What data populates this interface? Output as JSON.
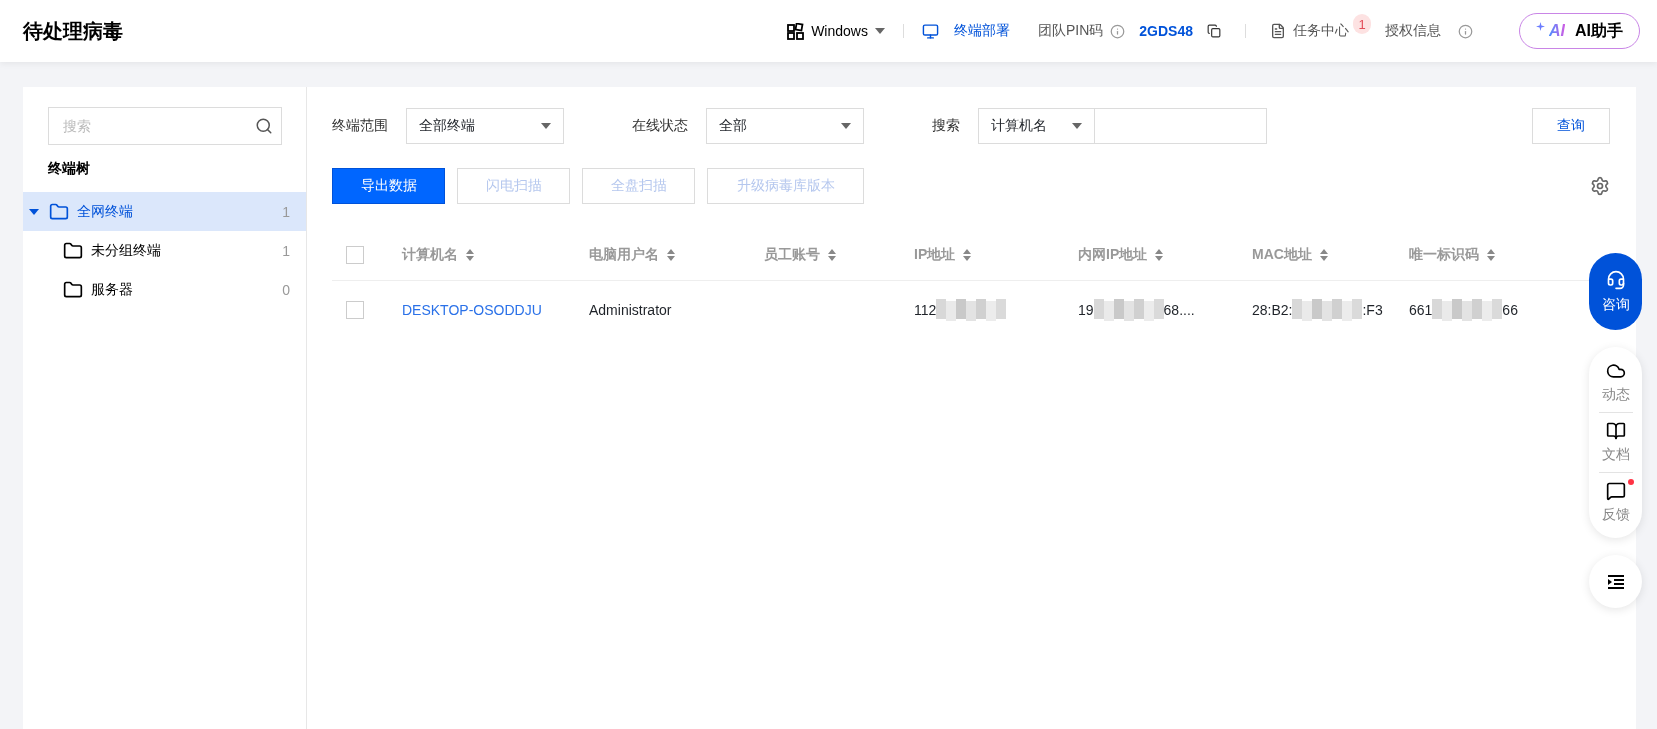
{
  "header": {
    "title": "待处理病毒",
    "os_select": "Windows",
    "deploy_link": "终端部署",
    "pin_label": "团队PIN码",
    "pin_value": "2GDS48",
    "task_center": "任务中心",
    "task_badge": "1",
    "license": "授权信息",
    "ai_logo": "AI",
    "ai_button": "AI助手"
  },
  "sidebar": {
    "search_placeholder": "搜索",
    "tree_title": "终端树",
    "tree": [
      {
        "label": "全网终端",
        "count": "1",
        "selected": true,
        "expanded": true,
        "children": [
          {
            "label": "未分组终端",
            "count": "1",
            "selected": false
          },
          {
            "label": "服务器",
            "count": "0",
            "selected": false
          }
        ]
      }
    ]
  },
  "filters": [
    {
      "kind": "select",
      "label": "终端范围",
      "value": "全部终端"
    },
    {
      "kind": "select",
      "label": "在线状态",
      "value": "全部"
    },
    {
      "kind": "search",
      "label": "搜索",
      "value": "计算机名"
    }
  ],
  "query_button": "查询",
  "actions": [
    {
      "label": "导出数据",
      "disabled": false
    },
    {
      "label": "闪电扫描",
      "disabled": true
    },
    {
      "label": "全盘扫描",
      "disabled": true
    },
    {
      "label": "升级病毒库版本",
      "disabled": true
    }
  ],
  "table": {
    "all_checked": false,
    "columns": [
      "计算机名",
      "电脑用户名",
      "员工账号",
      "IP地址",
      "内网IP地址",
      "MAC地址",
      "唯一标识码"
    ],
    "rows": [
      {
        "checked": false,
        "cells": [
          [
            {
              "kind": "link",
              "text": "DESKTOP-OSODDJU"
            }
          ],
          [
            {
              "kind": "text",
              "text": "Administrator"
            }
          ],
          [],
          [
            {
              "kind": "text",
              "text": "112"
            },
            {
              "kind": "redacted"
            }
          ],
          [
            {
              "kind": "text",
              "text": "19"
            },
            {
              "kind": "redacted"
            },
            {
              "kind": "text",
              "text": "68...."
            }
          ],
          [
            {
              "kind": "text",
              "text": "28:B2:"
            },
            {
              "kind": "redacted"
            },
            {
              "kind": "text",
              "text": ":F3"
            }
          ],
          [
            {
              "kind": "text",
              "text": "661"
            },
            {
              "kind": "redacted"
            },
            {
              "kind": "text",
              "text": "66"
            }
          ]
        ]
      }
    ]
  },
  "float_bar": {
    "consult": "咨询",
    "items": [
      {
        "kind": "news",
        "label": "动态",
        "dot": false
      },
      {
        "kind": "docs",
        "label": "文档",
        "dot": false
      },
      {
        "kind": "feedback",
        "label": "反馈",
        "dot": true
      }
    ]
  }
}
